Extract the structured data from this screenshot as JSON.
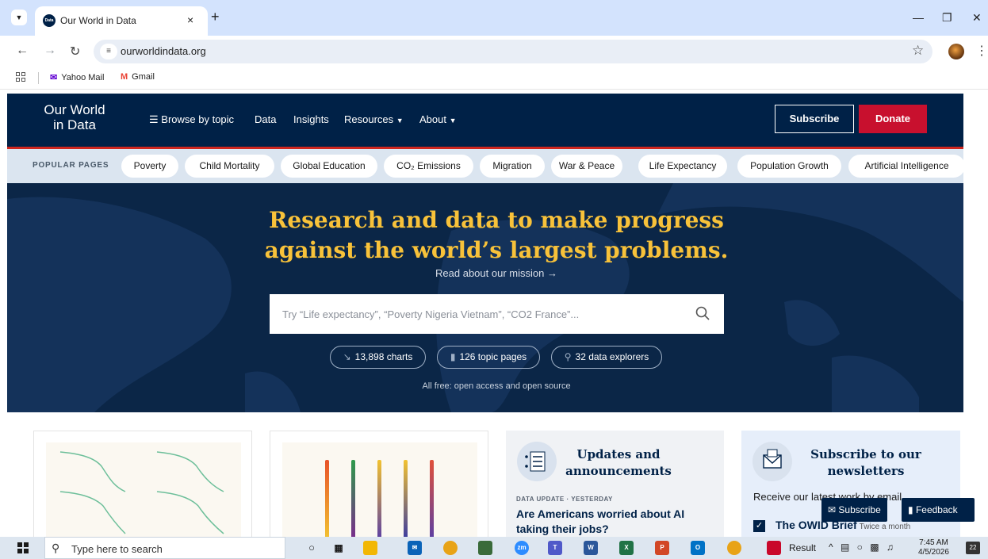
{
  "browser": {
    "tab_title": "Our World in Data",
    "tab_close": "×",
    "new_tab": "+",
    "url": "ourworldindata.org",
    "bookmarks": [
      {
        "label": "Yahoo Mail",
        "icon": "mail-icon",
        "color": "#6001d2"
      },
      {
        "label": "Gmail",
        "icon": "gmail-icon",
        "color": "#ea4335"
      }
    ]
  },
  "header": {
    "logo_line1": "Our World",
    "logo_line2": "in Data",
    "nav": {
      "browse": "Browse by topic",
      "data": "Data",
      "insights": "Insights",
      "resources": "Resources",
      "about": "About"
    },
    "subscribe": "Subscribe",
    "donate": "Donate"
  },
  "popular": {
    "label": "POPULAR PAGES",
    "pages": [
      "Poverty",
      "Child Mortality",
      "Global Education",
      "CO₂ Emissions",
      "Migration",
      "War & Peace",
      "Life Expectancy",
      "Population Growth",
      "Artificial Intelligence"
    ]
  },
  "hero": {
    "title_line1": "Research and data to make progress",
    "title_line2": "against the world’s largest problems.",
    "mission_link": "Read about our mission →",
    "search_placeholder": "Try “Life expectancy”, “Poverty Nigeria Vietnam”, “CO2 France”...",
    "stats": {
      "charts": "13,898 charts",
      "topic_pages": "126 topic pages",
      "explorers": "32 data explorers"
    },
    "free_note": "All free: open access and open source"
  },
  "cards": {
    "updates_title": "Updates and announcements",
    "update_kicker": "DATA UPDATE · YESTERDAY",
    "update_headline": "Are Americans worried about AI taking their jobs?",
    "newsletter_title": "Subscribe to our newsletters",
    "newsletter_intro": "Receive our latest work by email.",
    "brief_name": "The OWID Brief",
    "brief_freq": "Twice a month"
  },
  "floating": {
    "subscribe": "Subscribe",
    "feedback": "Feedback"
  },
  "taskbar": {
    "search_text": "Type here to search",
    "result": "Result",
    "time": "7:45 AM",
    "date": "4/5/2026",
    "notifications": "22"
  },
  "colors": {
    "owid_navy": "#002147",
    "owid_red": "#ce261e",
    "donate_red": "#c8102e",
    "hero_gold": "#f8c23a",
    "popular_bg": "#dbe5f0"
  }
}
